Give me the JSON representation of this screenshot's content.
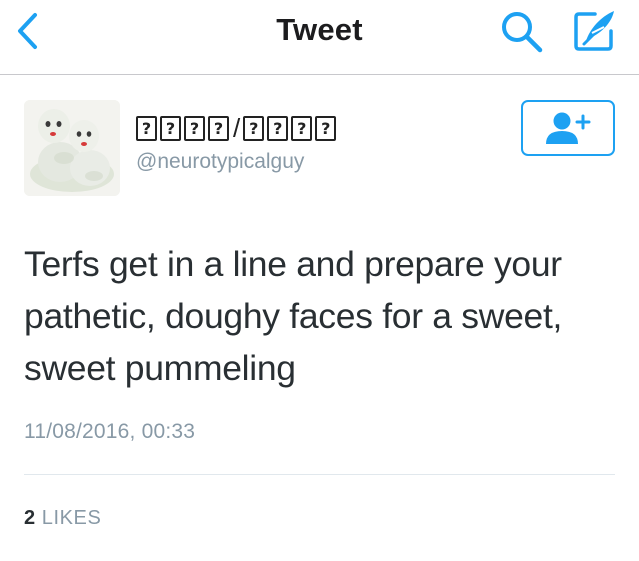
{
  "nav": {
    "title": "Tweet",
    "accent_color": "#1da1f2",
    "back_icon": "chevron-left-icon",
    "search_icon": "search-icon",
    "compose_icon": "compose-icon"
  },
  "author": {
    "display_name_glyphs": [
      "?",
      "?",
      "?",
      "?",
      "?",
      "?",
      "?",
      "?"
    ],
    "display_name_separator": "/",
    "handle": "@neurotypicalguy",
    "follow_icon": "add-user-icon"
  },
  "tweet": {
    "text": "Terfs get in a line and prepare your pathetic, doughy faces for a sweet, sweet pummeling",
    "timestamp": "11/08/2016, 00:33"
  },
  "stats": {
    "likes_count": "2",
    "likes_label": "LIKES"
  }
}
